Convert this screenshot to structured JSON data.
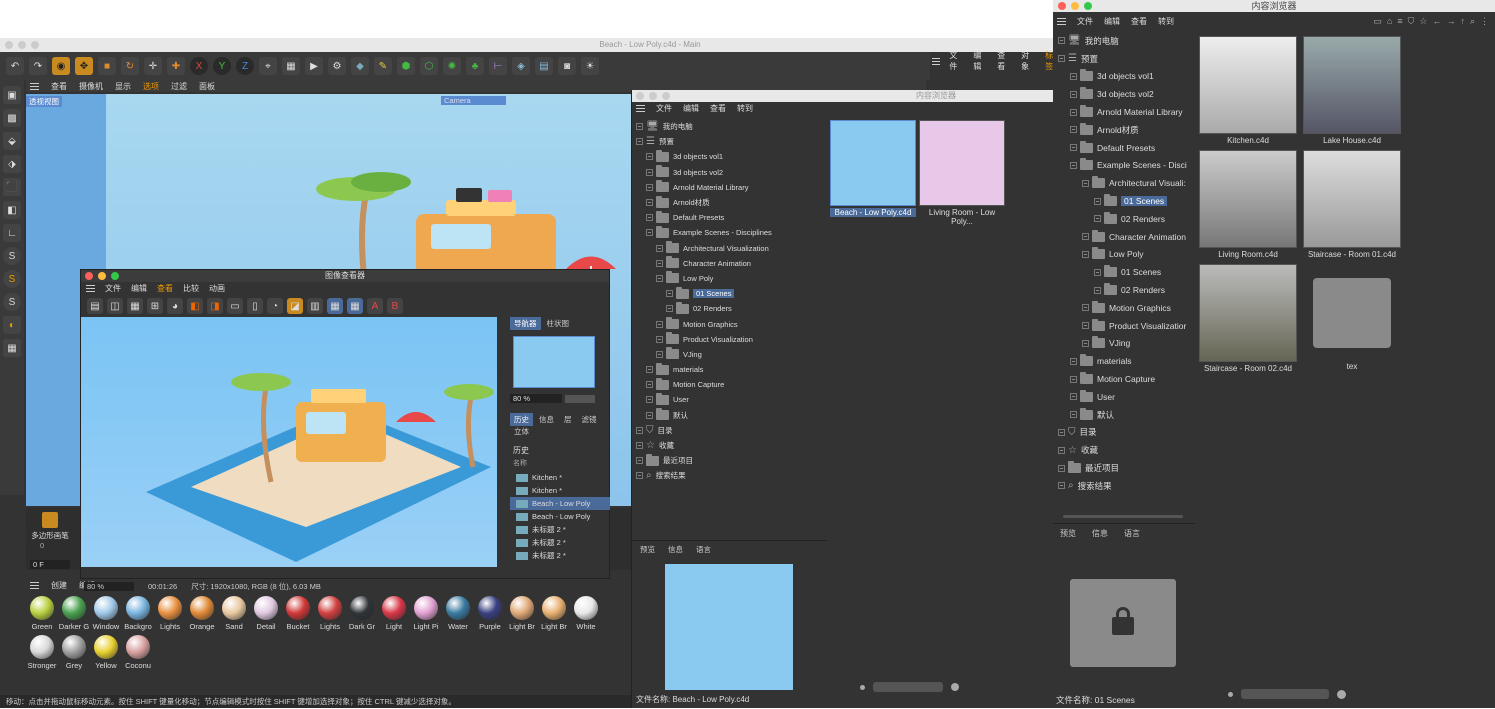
{
  "c4d": {
    "title": "Beach - Low Poly.c4d - Main",
    "viewport_menu": [
      "查看",
      "摄像机",
      "显示",
      "选项",
      "过滤",
      "面板"
    ],
    "viewport_label": "透视视图",
    "camera_label": "Camera",
    "frame_field": "0 F",
    "frame_value": "0",
    "timeline_left": "多边形画笔",
    "status": "移动：点击并拖动鼠标移动元素。按住 SHIFT 键量化移动；节点编辑模式时按住 SHIFT 键增加选择对象；按住 CTRL 键减少选择对象。",
    "right_mini_menu": [
      "文件",
      "编辑",
      "查看",
      "对象",
      "标签"
    ],
    "material_menu": [
      "创建",
      "编辑"
    ],
    "materials": [
      {
        "name": "Green",
        "color": "#b8d040"
      },
      {
        "name": "Darker G",
        "color": "#4aa050"
      },
      {
        "name": "Window",
        "color": "#a0c8e8"
      },
      {
        "name": "Backgro",
        "color": "#7ab4e0"
      },
      {
        "name": "Lights",
        "color": "#e89040"
      },
      {
        "name": "Orange",
        "color": "#e08a38"
      },
      {
        "name": "Sand",
        "color": "#e8c8a0"
      },
      {
        "name": "Detail",
        "color": "#e0c8e0"
      },
      {
        "name": "Bucket",
        "color": "#d03838"
      },
      {
        "name": "Lights",
        "color": "#d04040"
      },
      {
        "name": "Dark Gr",
        "color": "#303438"
      },
      {
        "name": "Light",
        "color": "#d83848"
      },
      {
        "name": "Light Pi",
        "color": "#e0a0d0"
      },
      {
        "name": "Water",
        "color": "#3a7aa0"
      },
      {
        "name": "Purple",
        "color": "#3a4080"
      },
      {
        "name": "Light Br",
        "color": "#e0a878"
      },
      {
        "name": "Light Br",
        "color": "#e8b070"
      },
      {
        "name": "White",
        "color": "#e8e8e8"
      },
      {
        "name": "Stronger",
        "color": "#d8d8d8"
      },
      {
        "name": "Grey",
        "color": "#a0a0a0"
      },
      {
        "name": "Yellow",
        "color": "#e8d030"
      },
      {
        "name": "Coconu",
        "color": "#d8a0a0"
      }
    ]
  },
  "image_viewer": {
    "title": "图像查看器",
    "menu": [
      "文件",
      "编辑",
      "查看",
      "比较",
      "动画"
    ],
    "tabs": [
      "导航器",
      "柱状图"
    ],
    "zoom": "80 %",
    "tabs2": [
      "历史",
      "信息",
      "层",
      "滤镜"
    ],
    "tab_extra": "立体",
    "history_title": "历史",
    "history_col": "名称",
    "history": [
      "Kitchen *",
      "Kitchen *",
      "Beach - Low Poly",
      "Beach - Low Poly",
      "未标题 2 *",
      "未标题 2 *",
      "未标题 2 *"
    ],
    "history_selected": 2,
    "bottom_zoom": "80 %",
    "bottom_time": "00:01:26",
    "bottom_info": "尺寸: 1920x1080, RGB (8 位), 6.03 MB"
  },
  "cb_mid": {
    "title": "内容浏览器",
    "menu": [
      "文件",
      "编辑",
      "查看",
      "转到"
    ],
    "tree": [
      {
        "t": "我的电脑",
        "d": 0,
        "icon": "pc"
      },
      {
        "t": "预置",
        "d": 0,
        "icon": "preset"
      },
      {
        "t": "3d objects vol1",
        "d": 1
      },
      {
        "t": "3d objects vol2",
        "d": 1
      },
      {
        "t": "Arnold Material Library",
        "d": 1
      },
      {
        "t": "Arnold材质",
        "d": 1
      },
      {
        "t": "Default Presets",
        "d": 1
      },
      {
        "t": "Example Scenes - Disciplines",
        "d": 1
      },
      {
        "t": "Architectural Visualization",
        "d": 2
      },
      {
        "t": "Character Animation",
        "d": 2
      },
      {
        "t": "Low Poly",
        "d": 2
      },
      {
        "t": "01 Scenes",
        "d": 3,
        "sel": true
      },
      {
        "t": "02 Renders",
        "d": 3
      },
      {
        "t": "Motion Graphics",
        "d": 2
      },
      {
        "t": "Product Visualization",
        "d": 2
      },
      {
        "t": "VJing",
        "d": 2
      },
      {
        "t": "materials",
        "d": 1
      },
      {
        "t": "Motion Capture",
        "d": 1
      },
      {
        "t": "User",
        "d": 1
      },
      {
        "t": "默认",
        "d": 1
      },
      {
        "t": "目录",
        "d": 0,
        "icon": "cat"
      },
      {
        "t": "收藏",
        "d": 0,
        "icon": "star"
      },
      {
        "t": "最近项目",
        "d": 0,
        "icon": "folder"
      },
      {
        "t": "搜索结果",
        "d": 0,
        "icon": "search"
      }
    ],
    "thumbs": [
      "Beach - Low Poly.c4d",
      "Living Room - Low Poly..."
    ],
    "preview_tabs": [
      "预览",
      "信息",
      "语言"
    ],
    "filename": "文件名称:  Beach - Low Poly.c4d"
  },
  "cb_right": {
    "title": "内容浏览器",
    "menu": [
      "文件",
      "编辑",
      "查看",
      "转到"
    ],
    "tree": [
      {
        "t": "我的电脑",
        "d": 0,
        "icon": "pc"
      },
      {
        "t": "预置",
        "d": 0,
        "icon": "preset"
      },
      {
        "t": "3d objects vol1",
        "d": 1
      },
      {
        "t": "3d objects vol2",
        "d": 1
      },
      {
        "t": "Arnold Material Library",
        "d": 1
      },
      {
        "t": "Arnold材质",
        "d": 1
      },
      {
        "t": "Default Presets",
        "d": 1
      },
      {
        "t": "Example Scenes - Disci",
        "d": 1
      },
      {
        "t": "Architectural Visuali:",
        "d": 2
      },
      {
        "t": "01 Scenes",
        "d": 3,
        "sel": true
      },
      {
        "t": "02 Renders",
        "d": 3
      },
      {
        "t": "Character Animation",
        "d": 2
      },
      {
        "t": "Low Poly",
        "d": 2
      },
      {
        "t": "01 Scenes",
        "d": 3
      },
      {
        "t": "02 Renders",
        "d": 3
      },
      {
        "t": "Motion Graphics",
        "d": 2
      },
      {
        "t": "Product Visualizatior",
        "d": 2
      },
      {
        "t": "VJing",
        "d": 2
      },
      {
        "t": "materials",
        "d": 1
      },
      {
        "t": "Motion Capture",
        "d": 1
      },
      {
        "t": "User",
        "d": 1
      },
      {
        "t": "默认",
        "d": 1
      },
      {
        "t": "目录",
        "d": 0,
        "icon": "cat"
      },
      {
        "t": "收藏",
        "d": 0,
        "icon": "star"
      },
      {
        "t": "最近项目",
        "d": 0,
        "icon": "folder"
      },
      {
        "t": "搜索结果",
        "d": 0,
        "icon": "search"
      }
    ],
    "thumbs": [
      "Kitchen.c4d",
      "Lake House.c4d",
      "Living Room.c4d",
      "Staircase - Room 01.c4d",
      "Staircase - Room 02.c4d",
      "tex"
    ],
    "preview_tabs": [
      "预览",
      "信息",
      "语言"
    ],
    "filename": "文件名称:  01 Scenes"
  }
}
